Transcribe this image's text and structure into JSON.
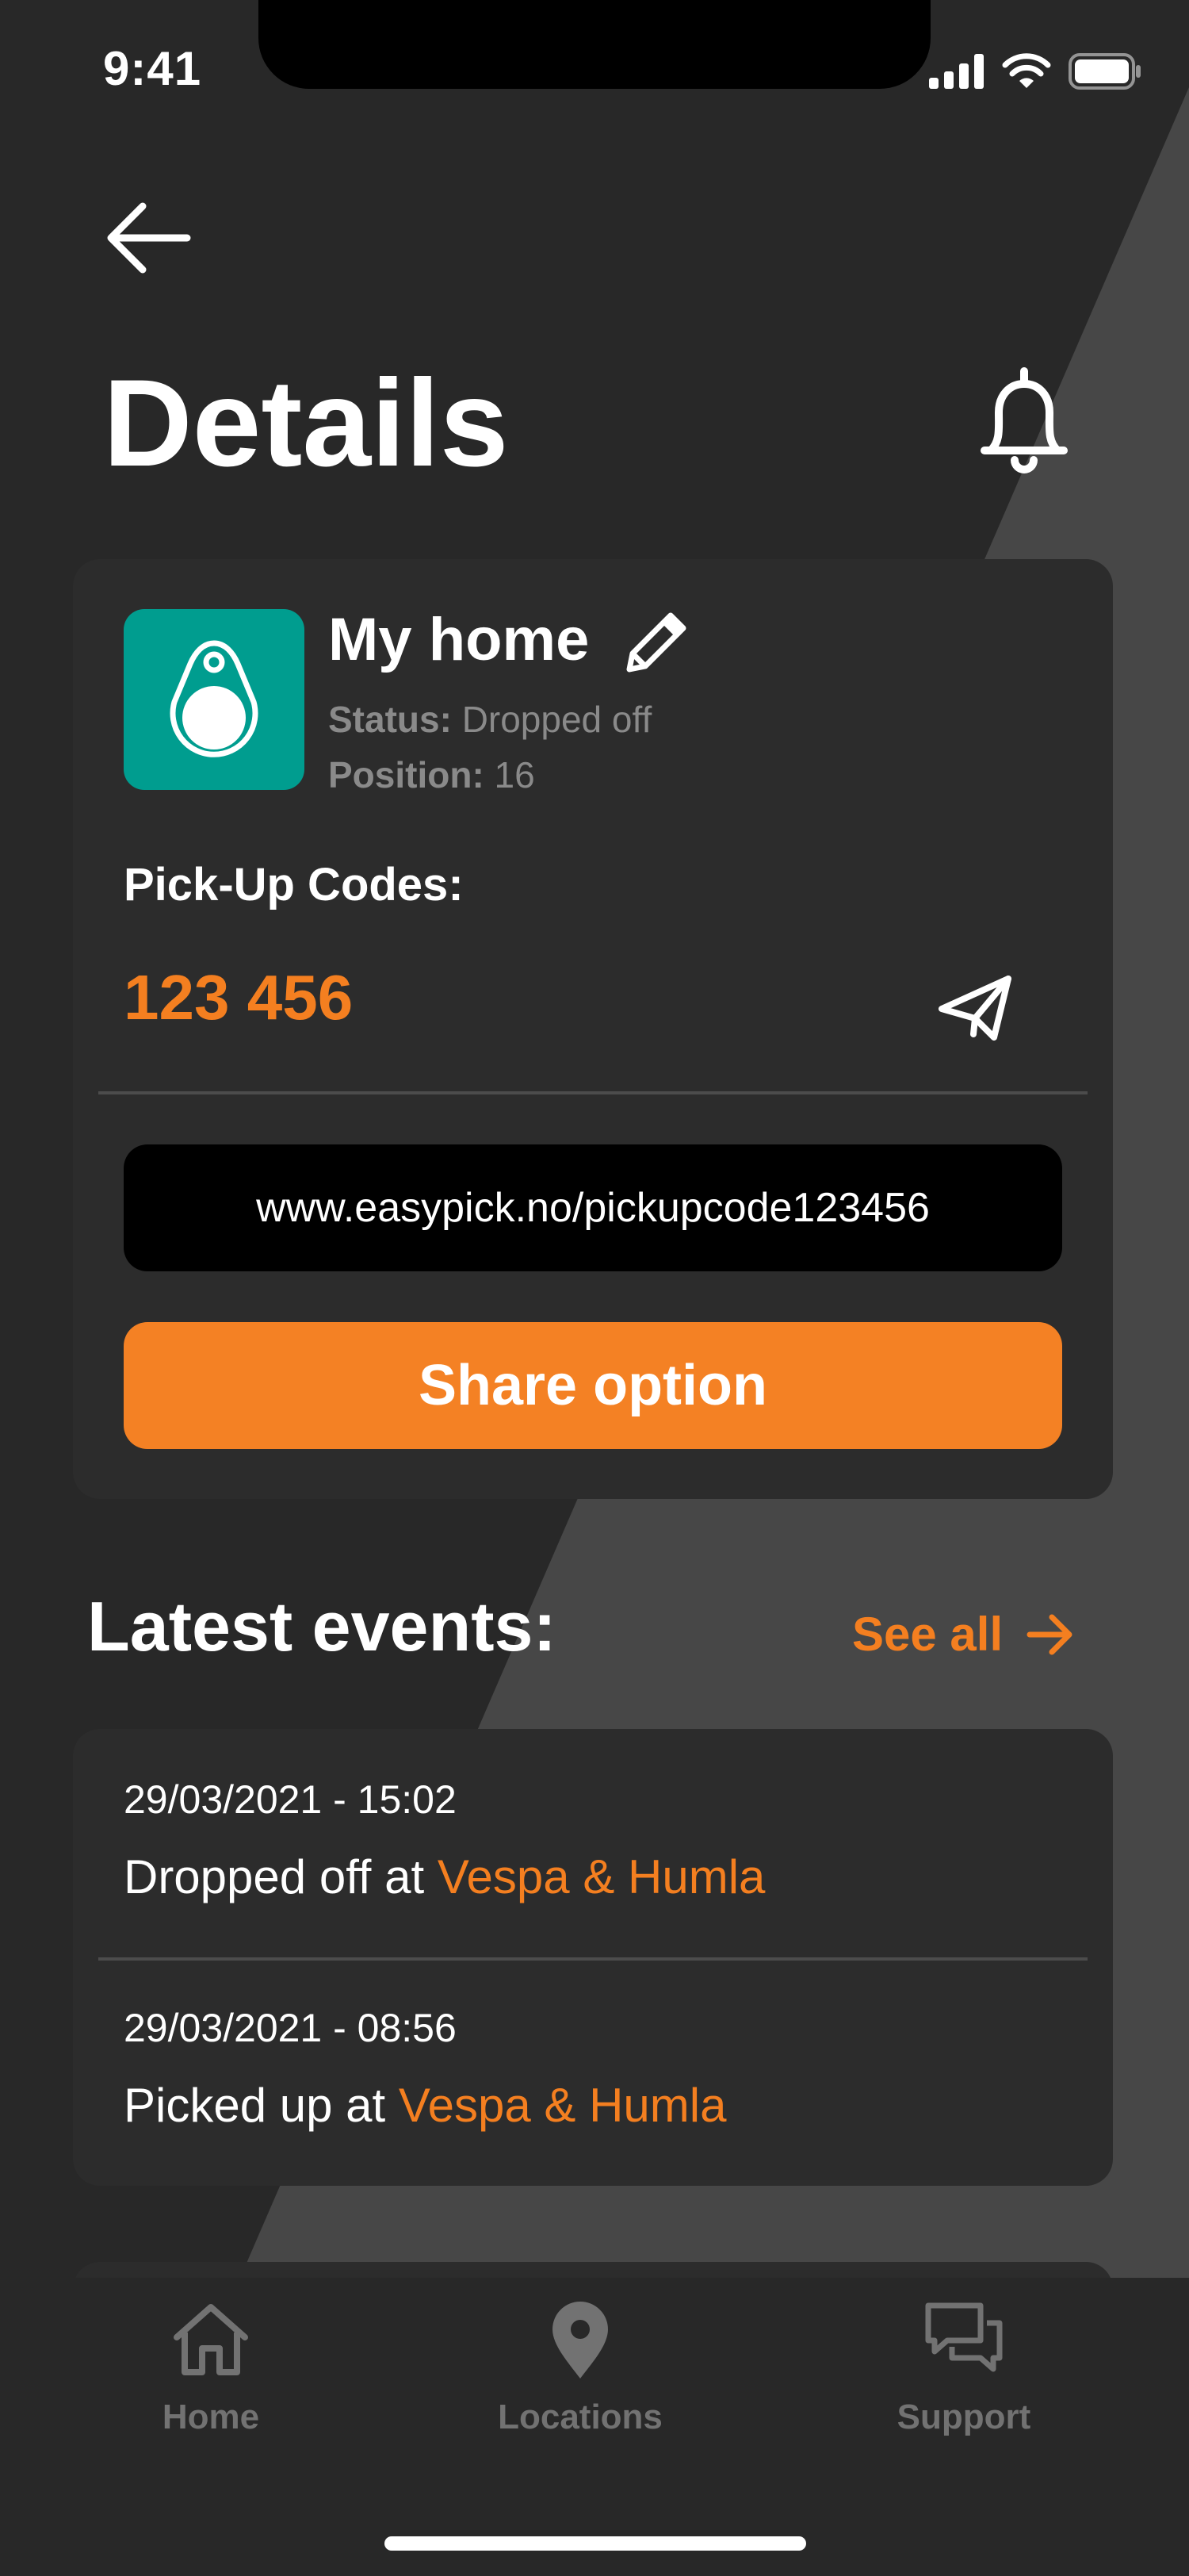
{
  "status_bar": {
    "time": "9:41"
  },
  "header": {
    "title": "Details"
  },
  "item": {
    "name": "My home",
    "status_label": "Status:",
    "status_value": "Dropped off",
    "position_label": "Position:",
    "position_value": "16",
    "codes_label": "Pick-Up Codes:",
    "code": "123 456",
    "url": "www.easypick.no/pickupcode123456",
    "share_label": "Share option"
  },
  "events": {
    "heading": "Latest events:",
    "see_all": "See all",
    "items": [
      {
        "date": "29/03/2021 - 15:02",
        "action": "Dropped off at",
        "place": "Vespa & Humla"
      },
      {
        "date": "29/03/2021 - 08:56",
        "action": "Picked up at",
        "place": "Vespa & Humla"
      }
    ]
  },
  "nav": {
    "items": [
      {
        "label": "Home",
        "icon": "home-icon"
      },
      {
        "label": "Locations",
        "icon": "location-pin-icon"
      },
      {
        "label": "Support",
        "icon": "chat-bubbles-icon"
      }
    ]
  },
  "colors": {
    "accent": "#f47f20",
    "tile": "#009d8f",
    "background": "#282828",
    "card": "#2c2c2c"
  }
}
